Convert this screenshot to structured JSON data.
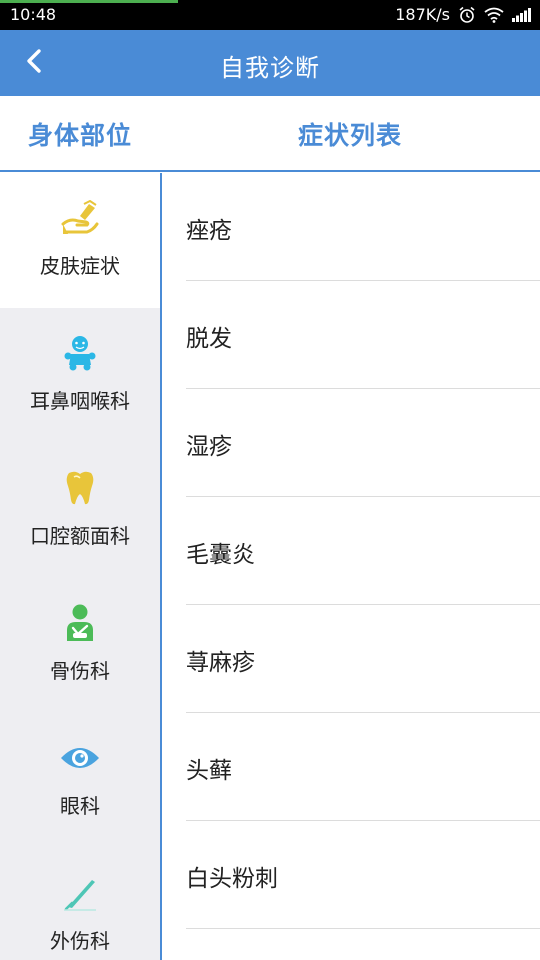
{
  "status_bar": {
    "time": "10:48",
    "network_speed": "187K/s",
    "icons": [
      "alarm-icon",
      "wifi-icon",
      "signal-icon"
    ]
  },
  "header": {
    "title": "自我诊断",
    "back_icon": "back-arrow-icon"
  },
  "columns": {
    "left_title": "身体部位",
    "right_title": "症状列表"
  },
  "categories": [
    {
      "label": "皮肤症状",
      "icon": "skin-hand-icon",
      "color": "#e8c53a",
      "active": true
    },
    {
      "label": "耳鼻咽喉科",
      "icon": "baby-icon",
      "color": "#2bb7e6",
      "active": false
    },
    {
      "label": "口腔额面科",
      "icon": "tooth-icon",
      "color": "#e8c53a",
      "active": false
    },
    {
      "label": "骨伤科",
      "icon": "injured-person-icon",
      "color": "#4cbb58",
      "active": false
    },
    {
      "label": "眼科",
      "icon": "eye-icon",
      "color": "#4aa3df",
      "active": false
    },
    {
      "label": "外伤科",
      "icon": "scalpel-icon",
      "color": "#4ec6b6",
      "active": false
    }
  ],
  "symptoms": [
    "痤疮",
    "脱发",
    "湿疹",
    "毛囊炎",
    "荨麻疹",
    "头藓",
    "白头粉刺"
  ],
  "colors": {
    "accent": "#4a8bd6",
    "sidebar_bg": "#eeeef2"
  }
}
